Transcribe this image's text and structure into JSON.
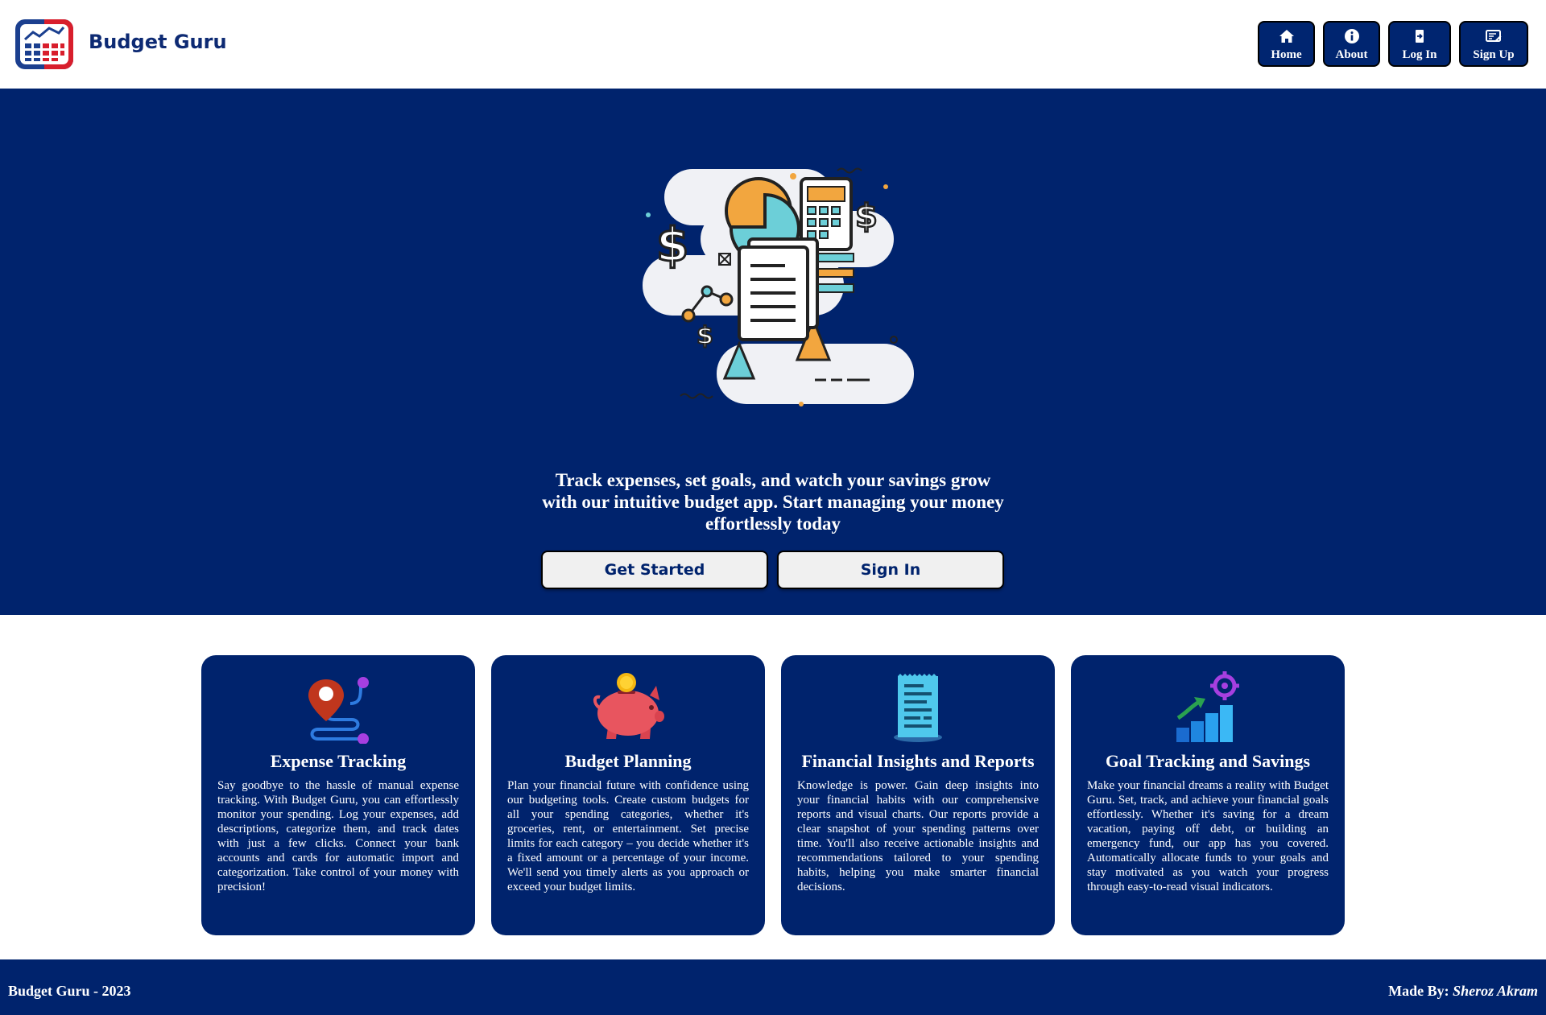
{
  "header": {
    "brand": "Budget Guru",
    "logo_icon": "budget-chart-logo",
    "nav": [
      {
        "label": "Home",
        "icon": "home-icon"
      },
      {
        "label": "About",
        "icon": "info-icon"
      },
      {
        "label": "Log In",
        "icon": "login-icon"
      },
      {
        "label": "Sign Up",
        "icon": "signup-icon"
      }
    ]
  },
  "hero": {
    "illustration_icon": "finance-illustration",
    "tagline": "Track expenses, set goals, and watch your savings grow with our intuitive budget app. Start managing your money effortlessly today",
    "get_started_label": "Get Started",
    "sign_in_label": "Sign In"
  },
  "features": [
    {
      "title": "Expense Tracking",
      "icon": "map-pin-route-icon",
      "text": "Say goodbye to the hassle of manual expense tracking. With Budget Guru, you can effortlessly monitor your spending. Log your expenses, add descriptions, categorize them, and track dates with just a few clicks. Connect your bank accounts and cards for automatic import and categorization. Take control of your money with precision!"
    },
    {
      "title": "Budget Planning",
      "icon": "piggy-bank-icon",
      "text": "Plan your financial future with confidence using our budgeting tools. Create custom budgets for all your spending categories, whether it's groceries, rent, or entertainment. Set precise limits for each category – you decide whether it's a fixed amount or a percentage of your income. We'll send you timely alerts as you approach or exceed your budget limits."
    },
    {
      "title": "Financial Insights and Reports",
      "icon": "receipt-report-icon",
      "text": "Knowledge is power. Gain deep insights into your financial habits with our comprehensive reports and visual charts. Our reports provide a clear snapshot of your spending patterns over time. You'll also receive actionable insights and recommendations tailored to your spending habits, helping you make smarter financial decisions."
    },
    {
      "title": "Goal Tracking and Savings",
      "icon": "growth-target-icon",
      "text": "Make your financial dreams a reality with Budget Guru. Set, track, and achieve your financial goals effortlessly. Whether it's saving for a dream vacation, paying off debt, or building an emergency fund, our app has you covered. Automatically allocate funds to your goals and stay motivated as you watch your progress through easy-to-read visual indicators."
    }
  ],
  "footer": {
    "left": "Budget Guru - 2023",
    "made_by_label": "Made By:",
    "author": "Sheroz Akram"
  },
  "colors": {
    "primary": "#00236d",
    "brand_text": "#0d2a73",
    "button_bg": "#f0f0f0"
  }
}
